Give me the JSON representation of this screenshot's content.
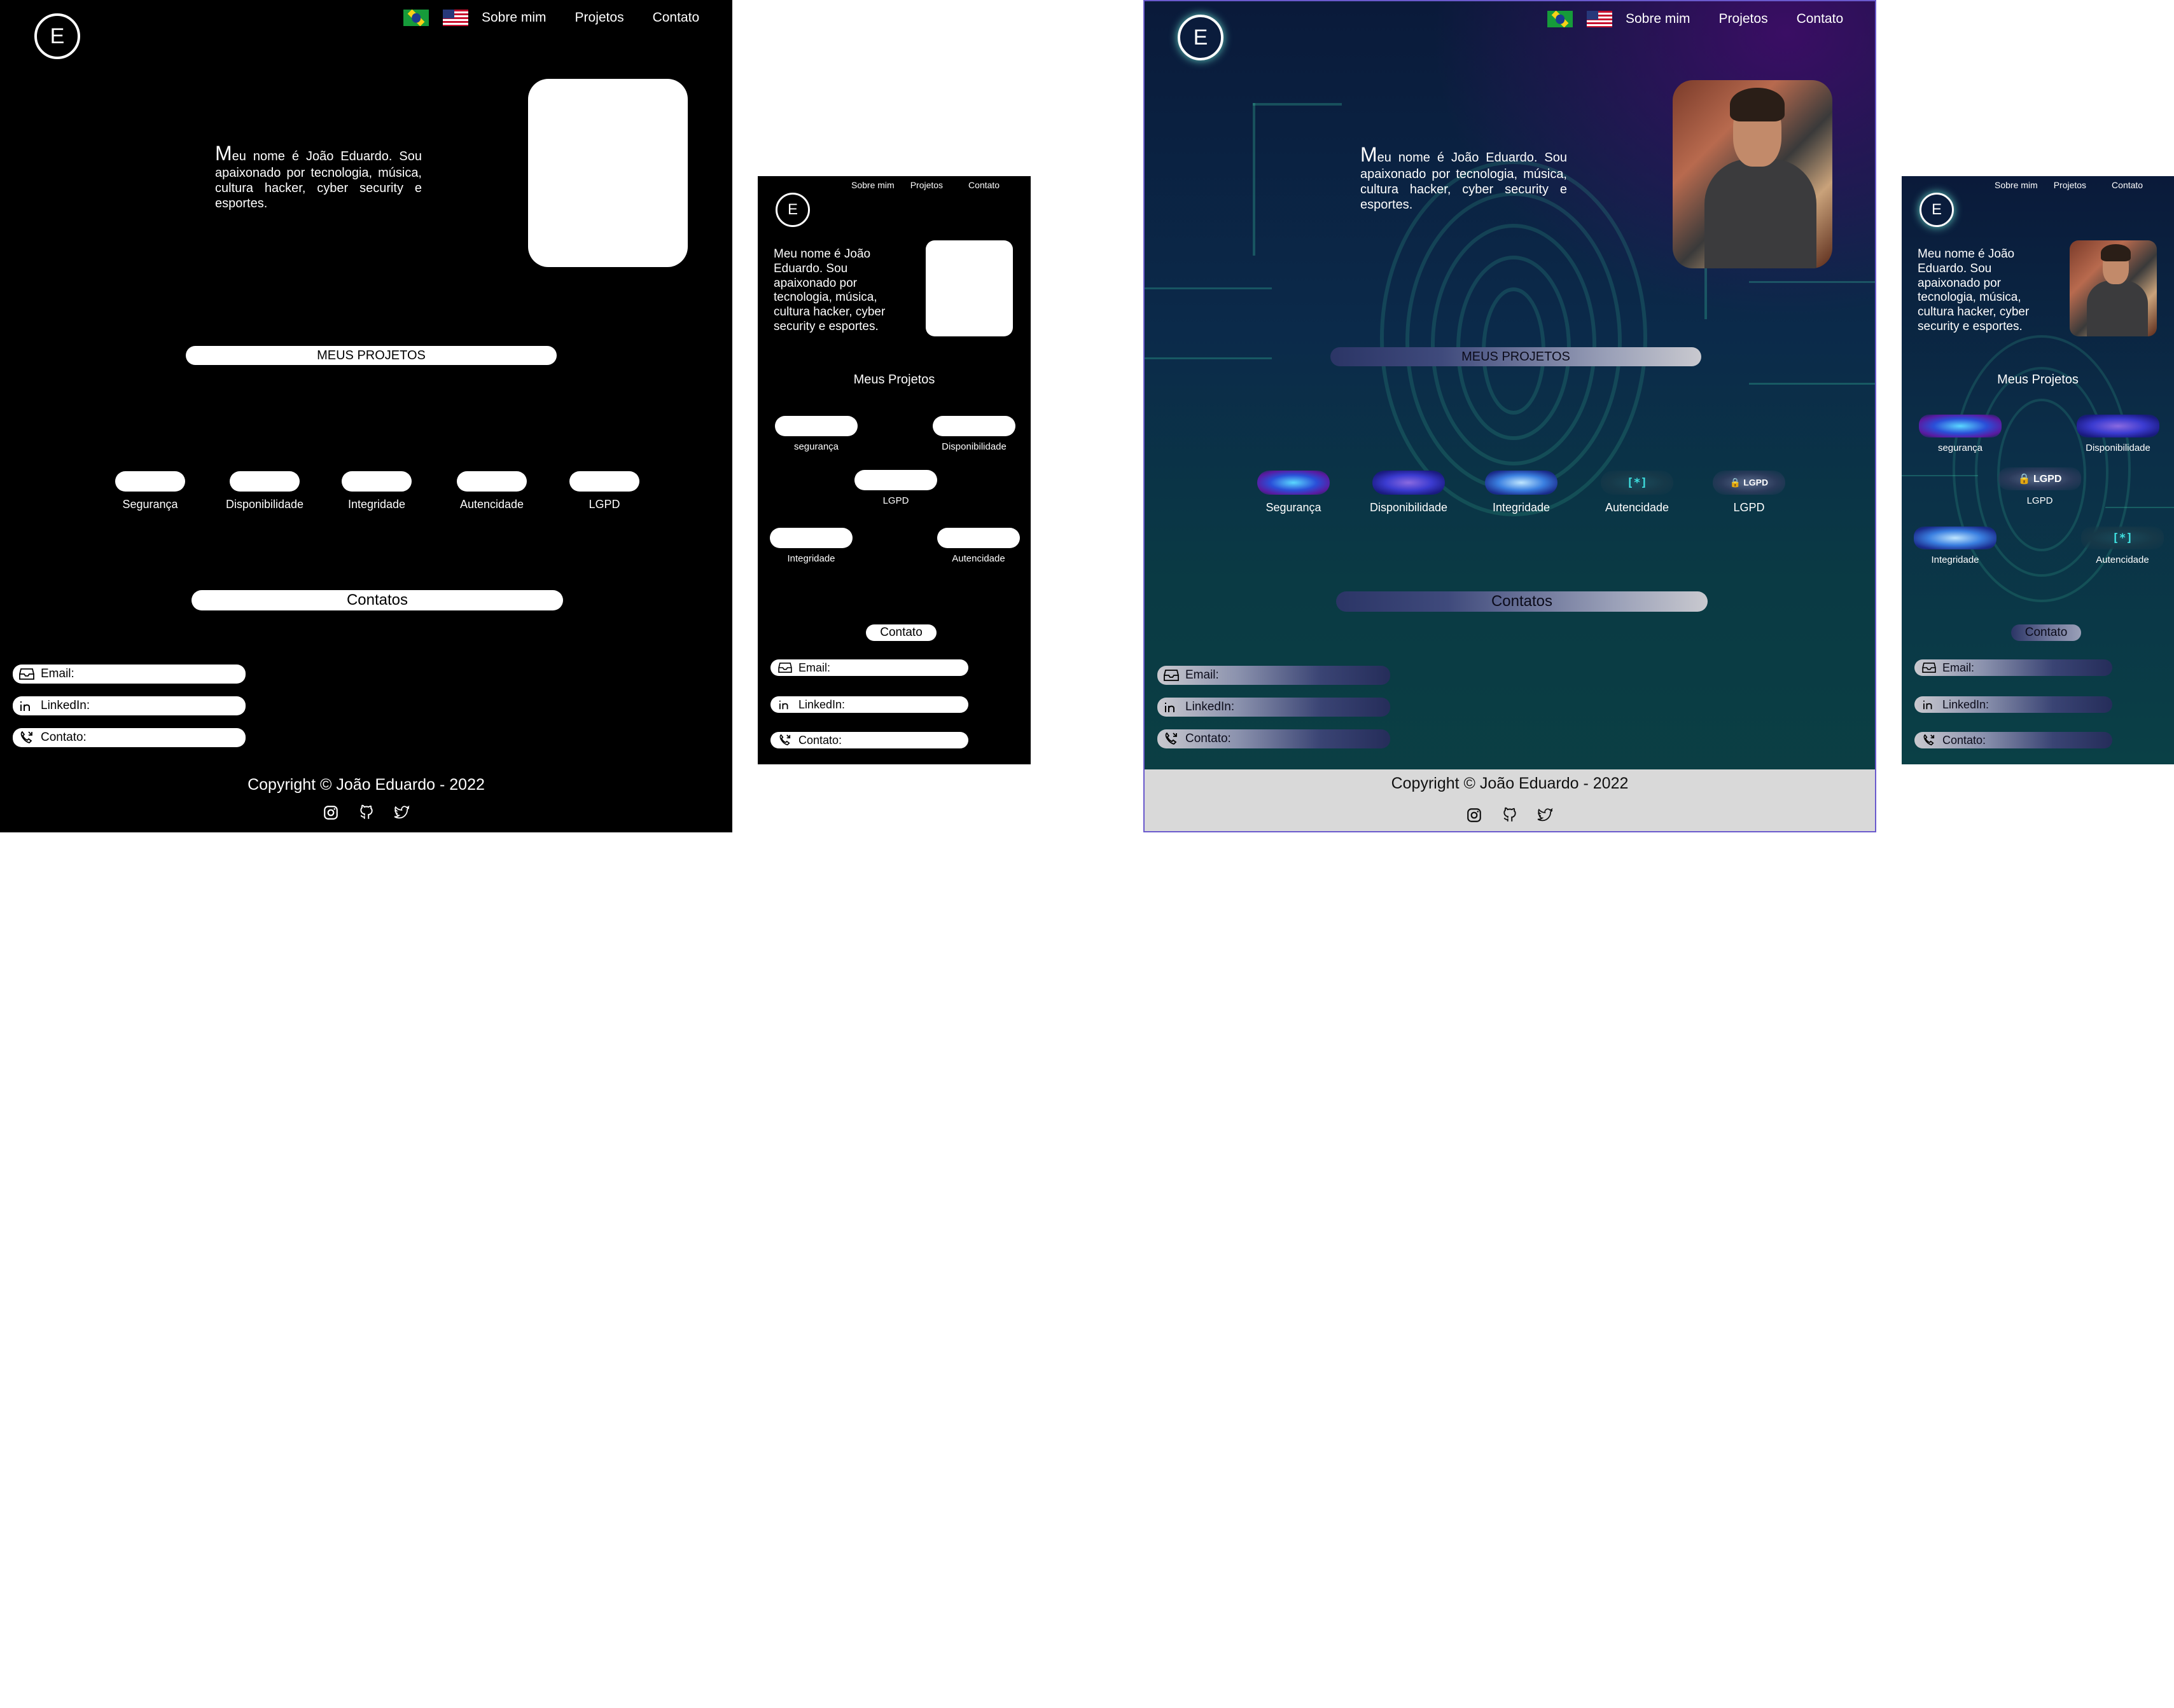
{
  "logo": {
    "letter": "E"
  },
  "nav": {
    "about": "Sobre mim",
    "projects": "Projetos",
    "contact": "Contato"
  },
  "intro": {
    "first_letter": "M",
    "rest": "eu nome é João Eduardo. Sou apaixonado por tecnologia, música, cultura hacker, cyber security e esportes.",
    "full": "Meu nome é João Eduardo. Sou apaixonado por tecnologia, música, cultura hacker, cyber security e esportes."
  },
  "projects": {
    "title_desktop": "MEUS PROJETOS",
    "title_mobile": "Meus Projetos",
    "items_desktop": [
      "Segurança",
      "Disponibilidade",
      "Integridade",
      "Autencidade",
      "LGPD"
    ],
    "items_mobile": [
      "segurança",
      "Disponibilidade",
      "LGPD",
      "Integridade",
      "Autencidade"
    ],
    "lgpd_badge": "LGPD",
    "aut_badge": "[*]"
  },
  "contacts": {
    "title_desktop": "Contatos",
    "title_mobile": "Contato",
    "email": "Email:",
    "linkedin": "LinkedIn:",
    "phone": "Contato:"
  },
  "footer": {
    "copyright": "Copyright © João Eduardo - 2022"
  },
  "icons": [
    "instagram-icon",
    "github-icon",
    "twitter-icon",
    "inbox-icon",
    "linkedin-icon",
    "phone-icon",
    "brazil-flag-icon",
    "usa-flag-icon"
  ],
  "colors": {
    "frame_dark": "#000000",
    "accent_border": "#6a5acd",
    "footer_band": "#d9d9d9",
    "glow": "#3fe0e0"
  }
}
